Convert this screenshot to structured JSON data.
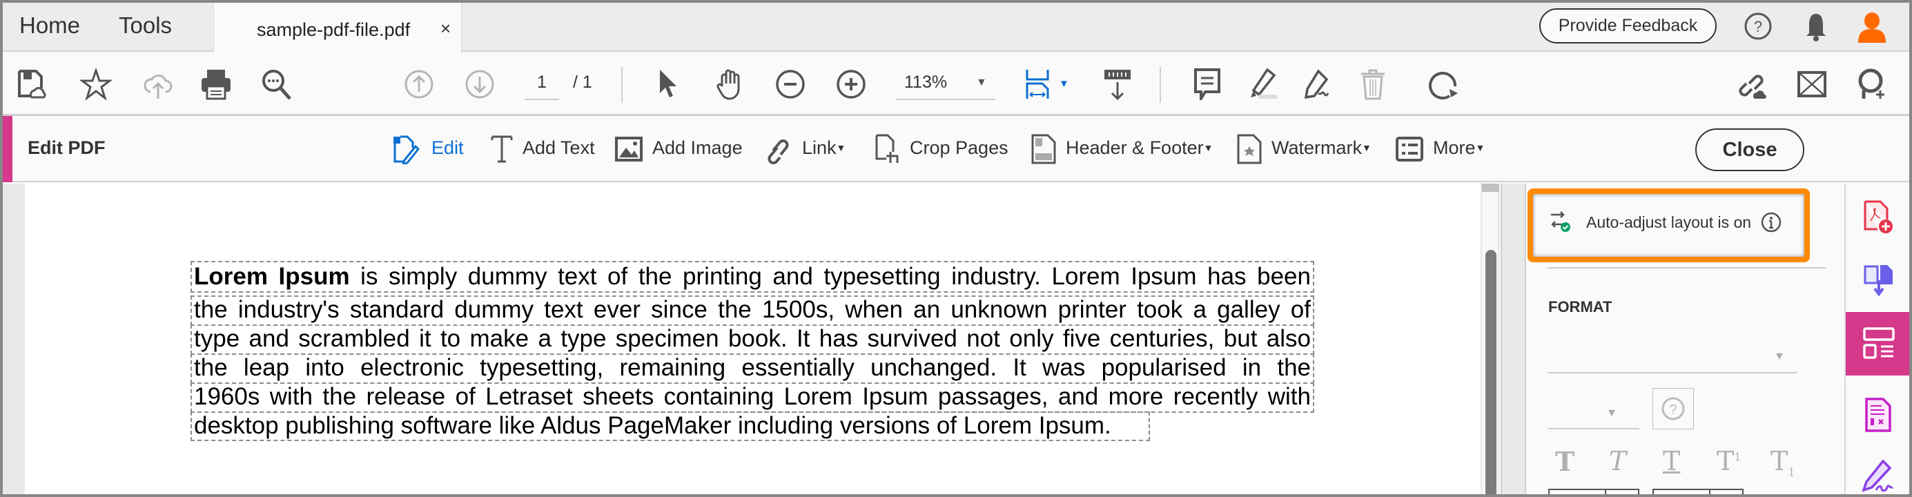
{
  "tabbar": {
    "home": "Home",
    "tools": "Tools",
    "active_tab": "sample-pdf-file.pdf",
    "close_tab": "×",
    "feedback": "Provide Feedback"
  },
  "toolbar": {
    "page_current": "1",
    "page_total": "/ 1",
    "zoom": "113%"
  },
  "editbar": {
    "title": "Edit PDF",
    "edit": "Edit",
    "add_text": "Add Text",
    "add_image": "Add Image",
    "link": "Link",
    "crop_pages": "Crop Pages",
    "header_footer": "Header & Footer",
    "watermark": "Watermark",
    "more": "More",
    "close": "Close"
  },
  "document": {
    "lead_bold": "Lorem Ipsum",
    "line1_rest": " is simply dummy text of the printing and typesetting industry. Lorem Ipsum has been",
    "lines": [
      "the industry's standard dummy text ever since the 1500s, when an unknown printer took a galley of",
      "type and scrambled it to make a type specimen book. It has survived not only five centuries, but also",
      "the leap into electronic typesetting, remaining essentially unchanged. It was popularised in the",
      "1960s with the release of Letraset sheets containing Lorem Ipsum passages, and more recently with",
      "desktop publishing software like Aldus PageMaker including versions of Lorem Ipsum."
    ]
  },
  "panel": {
    "auto_adjust": "Auto-adjust layout is on",
    "format_heading": "FORMAT",
    "highlight_color": "#ff8a00"
  },
  "colors": {
    "accent_pink": "#d6388c",
    "accent_blue": "#0a6fd3",
    "avatar_orange": "#ff6a00"
  }
}
